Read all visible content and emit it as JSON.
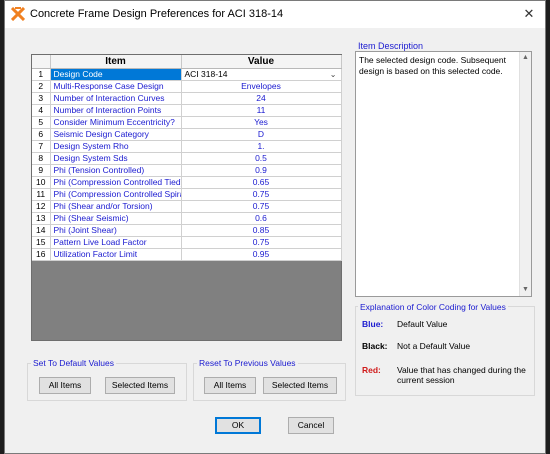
{
  "window": {
    "title": "Concrete Frame Design Preferences for ACI 318-14",
    "close_glyph": "✕"
  },
  "grid": {
    "headers": {
      "num": "",
      "item": "Item",
      "value": "Value"
    },
    "rows": [
      {
        "num": "1",
        "item": "Design Code",
        "value": "ACI 318-14"
      },
      {
        "num": "2",
        "item": "Multi-Response Case Design",
        "value": "Envelopes"
      },
      {
        "num": "3",
        "item": "Number of Interaction Curves",
        "value": "24"
      },
      {
        "num": "4",
        "item": "Number of Interaction Points",
        "value": "11"
      },
      {
        "num": "5",
        "item": "Consider Minimum Eccentricity?",
        "value": "Yes"
      },
      {
        "num": "6",
        "item": "Seismic Design Category",
        "value": "D"
      },
      {
        "num": "7",
        "item": "Design System Rho",
        "value": "1."
      },
      {
        "num": "8",
        "item": "Design System Sds",
        "value": "0.5"
      },
      {
        "num": "9",
        "item": "Phi (Tension Controlled)",
        "value": "0.9"
      },
      {
        "num": "10",
        "item": "Phi (Compression Controlled Tied)",
        "value": "0.65"
      },
      {
        "num": "11",
        "item": "Phi (Compression Controlled Spiral)",
        "value": "0.75"
      },
      {
        "num": "12",
        "item": "Phi (Shear and/or Torsion)",
        "value": "0.75"
      },
      {
        "num": "13",
        "item": "Phi (Shear Seismic)",
        "value": "0.6"
      },
      {
        "num": "14",
        "item": "Phi (Joint Shear)",
        "value": "0.85"
      },
      {
        "num": "15",
        "item": "Pattern Live Load Factor",
        "value": "0.75"
      },
      {
        "num": "16",
        "item": "Utilization Factor Limit",
        "value": "0.95"
      }
    ],
    "selected_row": 1
  },
  "description": {
    "label": "Item Description",
    "text": "The selected design code.  Subsequent design is based on this selected code."
  },
  "legend": {
    "label": "Explanation of Color Coding for Values",
    "entries": [
      {
        "key": "Blue:",
        "desc": "Default Value",
        "color": "#1a1ad0"
      },
      {
        "key": "Black:",
        "desc": "Not a Default Value",
        "color": "#000000"
      },
      {
        "key": "Red:",
        "desc": "Value that has changed during the current session",
        "color": "#d01a1a"
      }
    ]
  },
  "set_default": {
    "label": "Set To Default Values",
    "all_items": "All Items",
    "selected_items": "Selected Items"
  },
  "reset_previous": {
    "label": "Reset To Previous Values",
    "all_items": "All Items",
    "selected_items": "Selected Items"
  },
  "footer": {
    "ok": "OK",
    "cancel": "Cancel"
  },
  "colors": {
    "accent": "#0078d7",
    "default_value": "#1a1ad0",
    "window_bg": "#f0f0f0",
    "grid_empty": "#808080"
  }
}
